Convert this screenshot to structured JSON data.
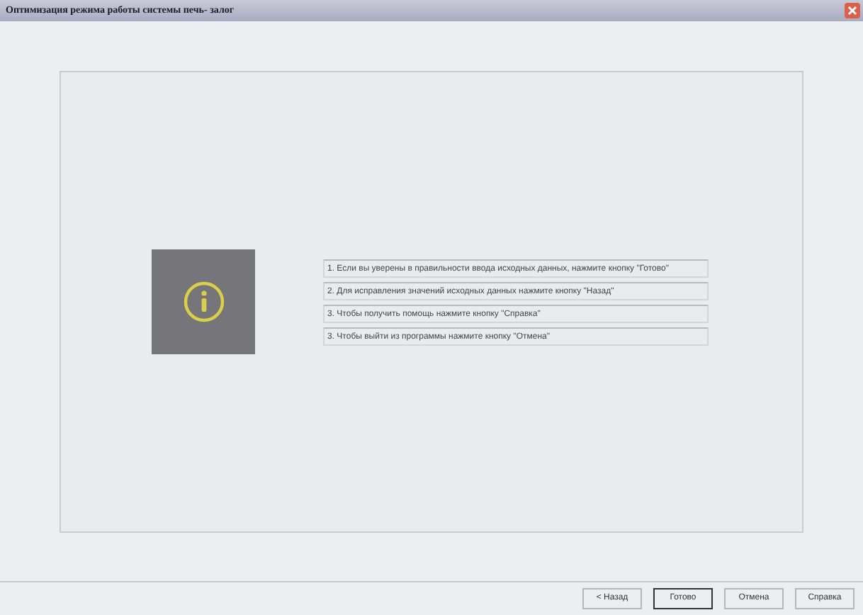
{
  "window": {
    "title": "Оптимизация режима работы системы печь- залог"
  },
  "messages": [
    "1. Если вы уверены в правильности ввода исходных данных, нажмите кнопку \"Готово\"",
    "2. Для исправления значений исходных данных нажмите кнопку \"Назад\"",
    "3. Чтобы получить помощь нажмите кнопку \"Справка\"",
    "3. Чтобы выйти из программы нажмите кнопку \"Отмена\""
  ],
  "buttons": [
    {
      "label": "< Назад",
      "selected": false
    },
    {
      "label": "Готово",
      "selected": true
    },
    {
      "label": "Отмена",
      "selected": false
    },
    {
      "label": "Справка",
      "selected": false
    }
  ]
}
